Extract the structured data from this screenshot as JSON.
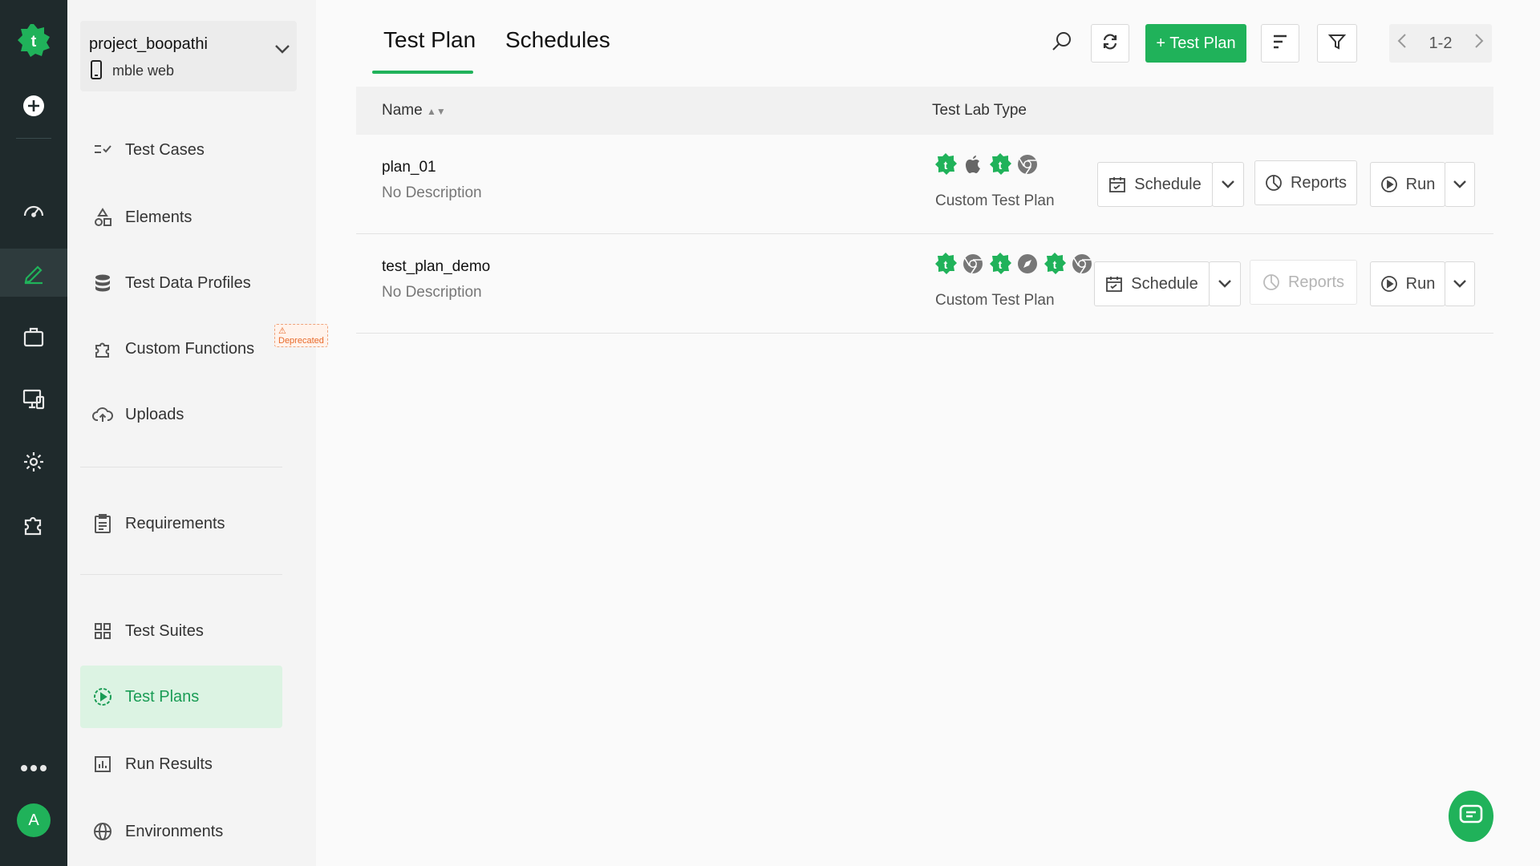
{
  "colors": {
    "accent": "#20b25a",
    "rail_bg": "#1f2a2c",
    "active_bg": "#dcf3e3",
    "deprecated": "#e86a2a"
  },
  "project": {
    "name": "project_boopathi",
    "platform": "mble web"
  },
  "sidebar": {
    "items": [
      {
        "label": "Test Cases",
        "icon": "test-cases-icon"
      },
      {
        "label": "Elements",
        "icon": "elements-icon"
      },
      {
        "label": "Test Data Profiles",
        "icon": "database-icon"
      },
      {
        "label": "Custom Functions",
        "icon": "puzzle-icon",
        "badge": "Deprecated"
      },
      {
        "label": "Uploads",
        "icon": "cloud-upload-icon"
      },
      {
        "label": "Requirements",
        "icon": "clipboard-icon"
      },
      {
        "label": "Test Suites",
        "icon": "grid-icon"
      },
      {
        "label": "Test Plans",
        "icon": "play-circle-icon",
        "active": true
      },
      {
        "label": "Run Results",
        "icon": "bar-chart-icon"
      },
      {
        "label": "Environments",
        "icon": "globe-icon"
      }
    ]
  },
  "rail": {
    "items": [
      "logo-icon",
      "add-icon",
      "dashboard-icon",
      "edit-icon",
      "briefcase-icon",
      "devices-icon",
      "settings-icon",
      "addons-icon",
      "more-icon"
    ],
    "avatar": "A"
  },
  "tabs": [
    "Test Plan",
    "Schedules"
  ],
  "toolbar": {
    "add_label": "+ Test Plan",
    "pager": "1-2"
  },
  "table": {
    "headers": {
      "name": "Name",
      "lab_type": "Test Lab Type"
    },
    "rows": [
      {
        "name": "plan_01",
        "description": "No Description",
        "lab_icons": [
          "testsigma",
          "apple",
          "testsigma",
          "chrome"
        ],
        "lab_type": "Custom Test Plan",
        "reports_enabled": true
      },
      {
        "name": "test_plan_demo",
        "description": "No Description",
        "lab_icons": [
          "testsigma",
          "chrome",
          "testsigma",
          "safari",
          "testsigma",
          "chrome"
        ],
        "lab_type": "Custom Test Plan",
        "reports_enabled": false
      }
    ],
    "actions": {
      "schedule": "Schedule",
      "reports": "Reports",
      "run": "Run"
    }
  }
}
